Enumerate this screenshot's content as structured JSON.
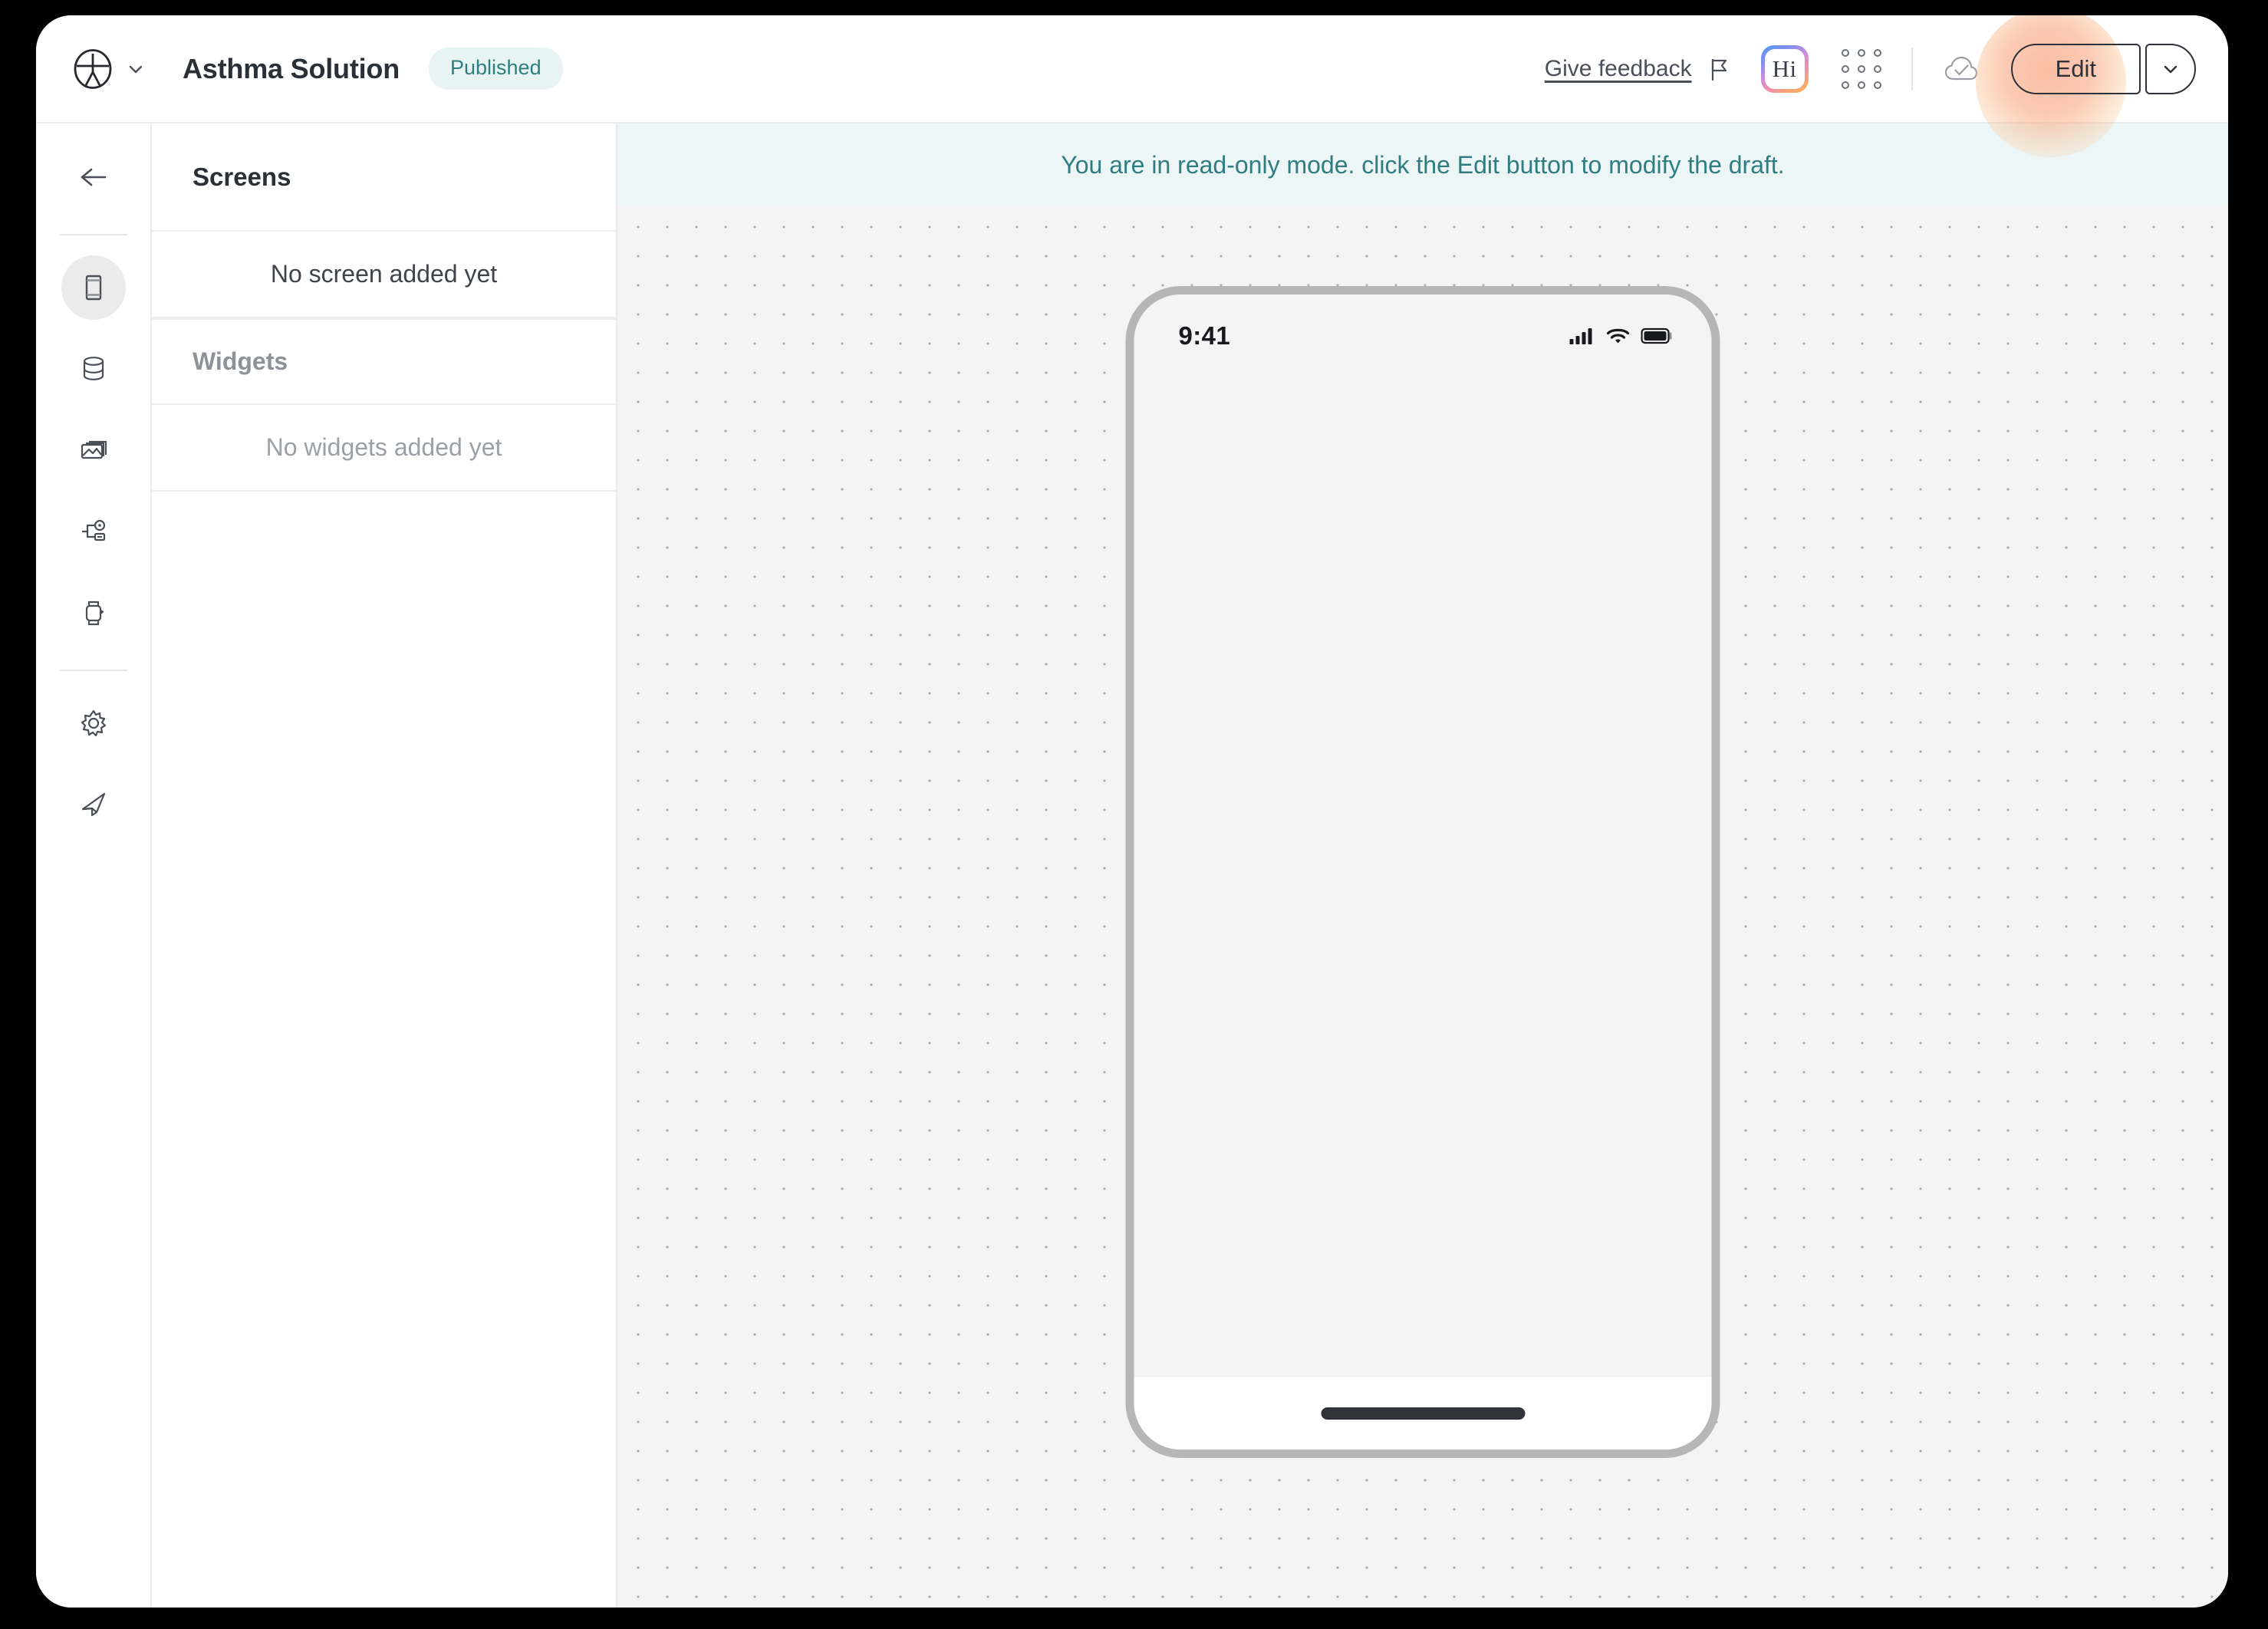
{
  "window": {
    "brand_logo_icon": "circle-person-logo-icon",
    "brand_caret_icon": "chevron-down-icon",
    "app_title": "Asthma Solution",
    "status_badge": "Published"
  },
  "toolbar": {
    "give_feedback_label": "Give feedback",
    "flag_icon": "flag-icon",
    "hi_badge_label": "Hi",
    "hi_badge_icon": "ai-assistant-hi-icon",
    "grid_menu_icon": "grid-dots-icon",
    "cloud_save_icon": "cloud-check-icon",
    "edit_label": "Edit",
    "edit_dropdown_icon": "chevron-down-icon"
  },
  "rail": {
    "back_icon": "arrow-left-icon",
    "items": [
      {
        "icon": "mobile-screen-icon",
        "name": "screens",
        "active": true
      },
      {
        "icon": "database-icon",
        "name": "data",
        "active": false
      },
      {
        "icon": "image-gallery-icon",
        "name": "media",
        "active": false
      },
      {
        "icon": "workflow-node-icon",
        "name": "integrations",
        "active": false
      },
      {
        "icon": "watch-icon",
        "name": "wearables",
        "active": false
      },
      {
        "icon": "gear-icon",
        "name": "settings",
        "active": false
      },
      {
        "icon": "rocket-icon",
        "name": "publish",
        "active": false
      }
    ]
  },
  "screens_panel": {
    "screens_header": "Screens",
    "screens_empty": "No screen added yet",
    "widgets_header": "Widgets",
    "widgets_empty": "No widgets added yet"
  },
  "canvas": {
    "readonly_banner": "You are in read-only mode. click the Edit button to modify the draft."
  },
  "phone": {
    "time": "9:41",
    "signal_icon": "cellular-signal-icon",
    "wifi_icon": "wifi-icon",
    "battery_icon": "battery-full-icon",
    "home_indicator_icon": "home-indicator"
  },
  "colors": {
    "accent_teal": "#2f7d80",
    "badge_bg": "#e7f4f3",
    "banner_bg": "#edf6f7",
    "canvas_bg": "#f4f4f4",
    "edit_glow": "#f9a280",
    "text_primary": "#2b2f36",
    "text_muted": "#9aa0a6"
  }
}
